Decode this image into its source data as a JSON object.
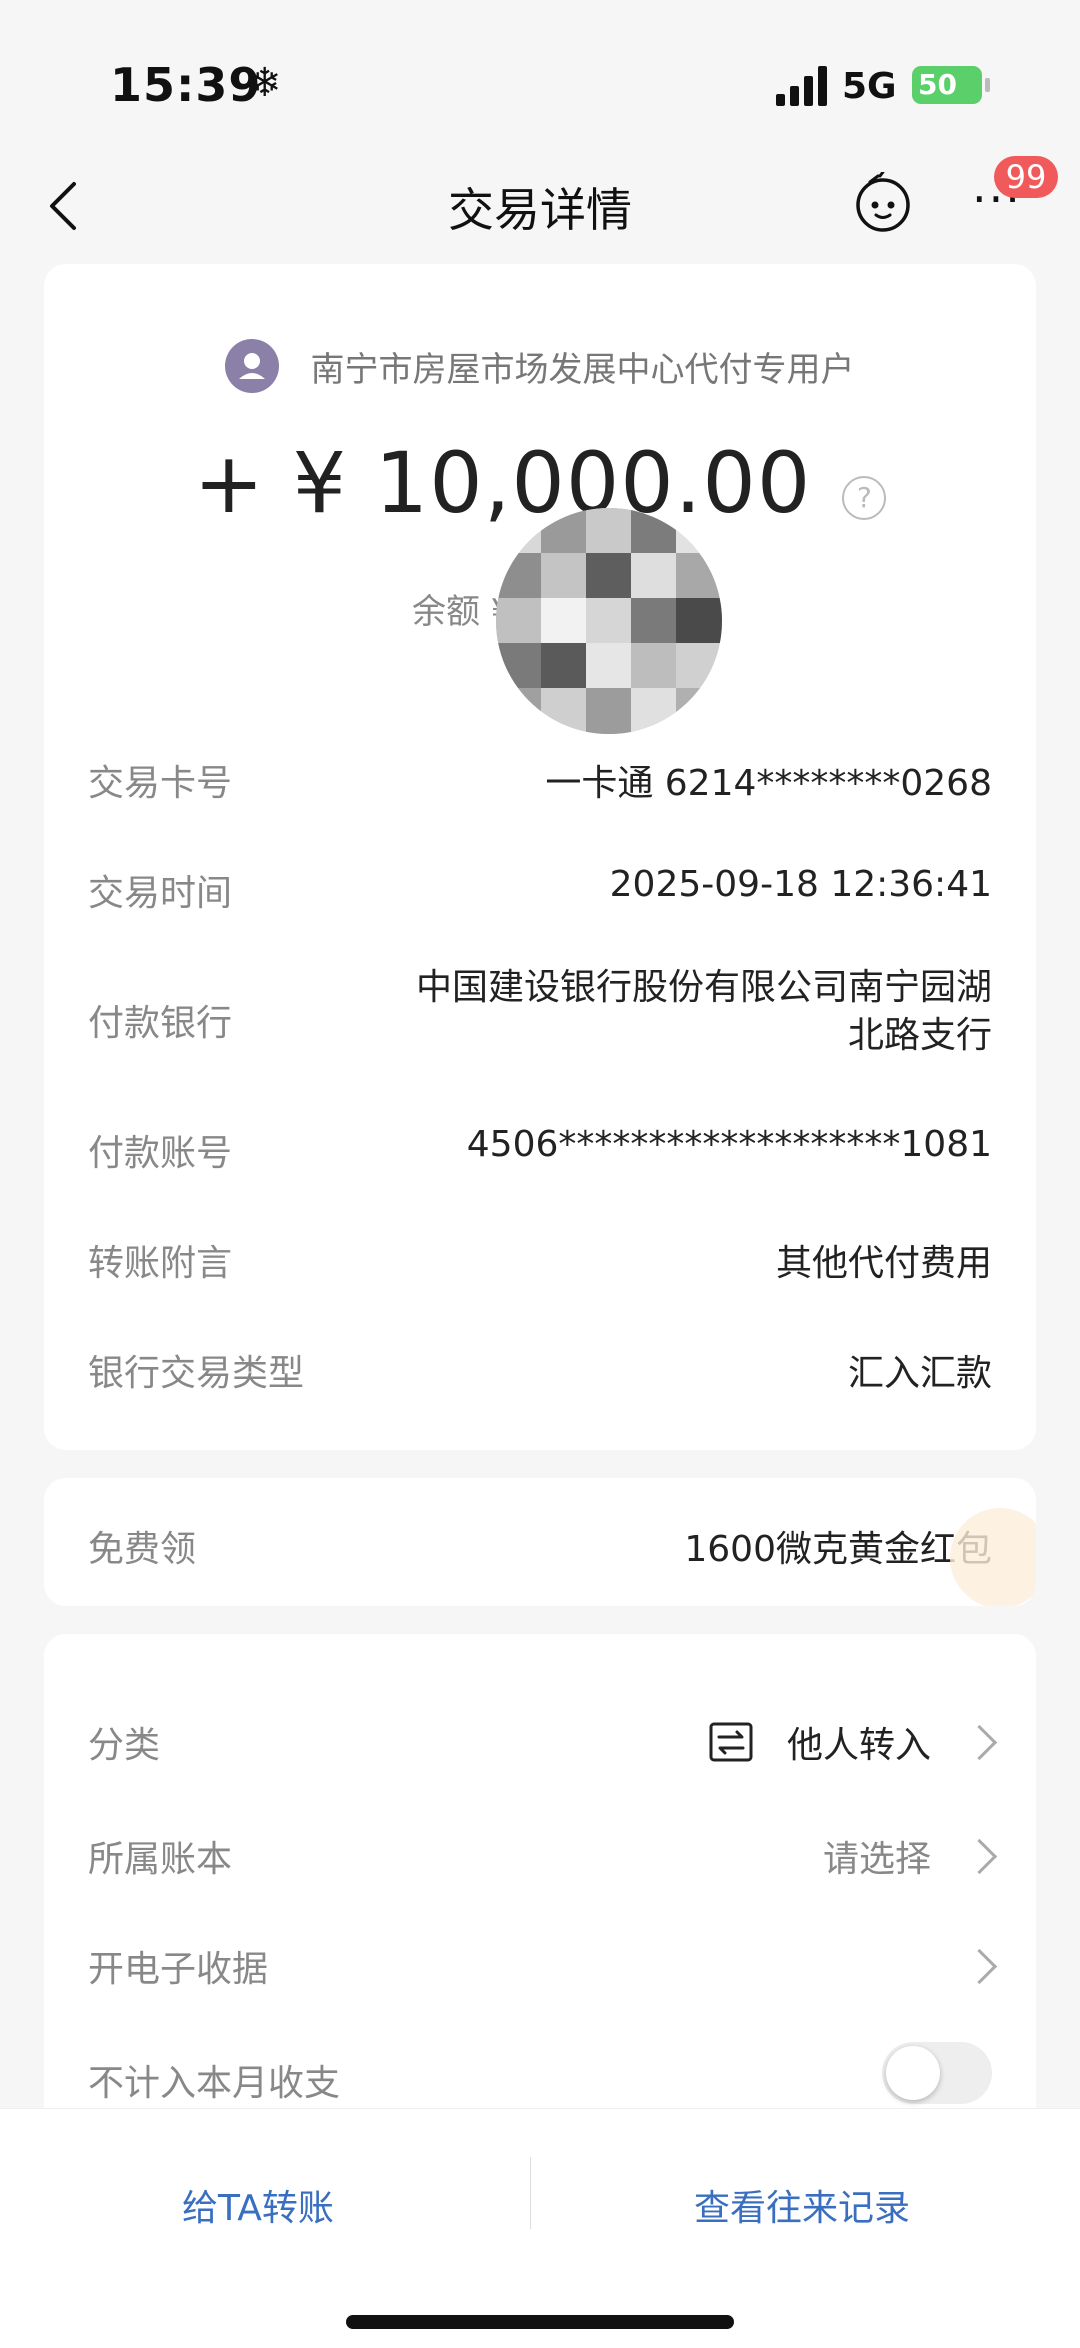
{
  "status_bar": {
    "time": "15:39",
    "weather_icon": "snowflake-icon",
    "network": "5G",
    "battery": "50"
  },
  "nav": {
    "title": "交易详情",
    "badge": "99"
  },
  "transaction": {
    "payer": "南宁市房屋市场发展中心代付专用户",
    "amount": "+ ¥ 10,000.00",
    "balance_label": "余额 ¥",
    "help": "?",
    "details": [
      {
        "label": "交易卡号",
        "value": "一卡通 6214********0268"
      },
      {
        "label": "交易时间",
        "value": "2025-09-18 12:36:41"
      },
      {
        "label": "付款银行",
        "value": "中国建设银行股份有限公司南宁园湖\n北路支行"
      },
      {
        "label": "付款账号",
        "value": "4506*******************1081"
      },
      {
        "label": "转账附言",
        "value": "其他代付费用"
      },
      {
        "label": "银行交易类型",
        "value": "汇入汇款"
      }
    ]
  },
  "gold": {
    "label": "免费领",
    "value": "1600微克黄金红包"
  },
  "extra": {
    "category_label": "分类",
    "category_value": "他人转入",
    "ledger_label": "所属账本",
    "ledger_value": "请选择",
    "receipt_label": "开电子收据",
    "exclude_label": "不计入本月收支",
    "exclude_enabled": false
  },
  "bottom": {
    "transfer_label": "给TA转账",
    "history_label": "查看往来记录"
  },
  "colors": {
    "accent": "#3a6fc0",
    "badge": "#f15a5a",
    "battery": "#5bd06a"
  }
}
